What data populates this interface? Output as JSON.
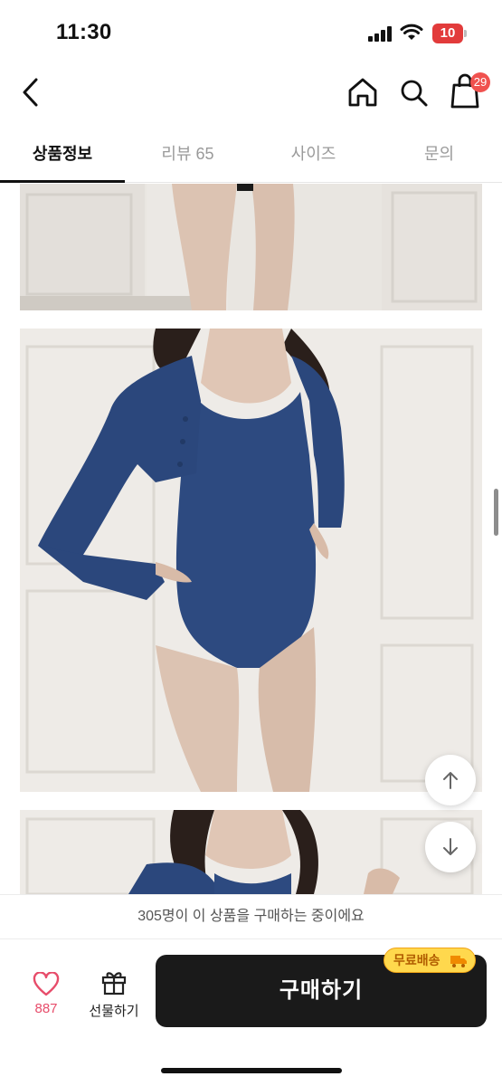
{
  "status_bar": {
    "time": "11:30",
    "battery_level": "10",
    "battery_color": "#e23b3b"
  },
  "top_nav": {
    "cart_count": "29",
    "badge_color": "#f0524f"
  },
  "tabs": [
    {
      "label": "상품정보",
      "active": true
    },
    {
      "label": "리뷰 65",
      "active": false
    },
    {
      "label": "사이즈",
      "active": false
    },
    {
      "label": "문의",
      "active": false
    }
  ],
  "icons": {
    "back": "chevron-left-icon",
    "home": "home-icon",
    "search": "search-icon",
    "cart": "shopping-bag-icon",
    "scroll_up": "arrow-up-icon",
    "scroll_down": "arrow-down-icon",
    "like": "heart-icon",
    "gift": "gift-icon",
    "truck": "truck-icon"
  },
  "purchase_info": "305명이 이 상품을 구매하는 중이에요",
  "bottom_bar": {
    "like_count": "887",
    "gift_label": "선물하기",
    "buy_label": "구매하기",
    "shipping_badge": "무료배송"
  },
  "colors": {
    "accent_like": "#e74c6a",
    "buy_button": "#1a1a1a",
    "shipping_badge": "#ffd84d",
    "garment": "#2d4a80"
  }
}
